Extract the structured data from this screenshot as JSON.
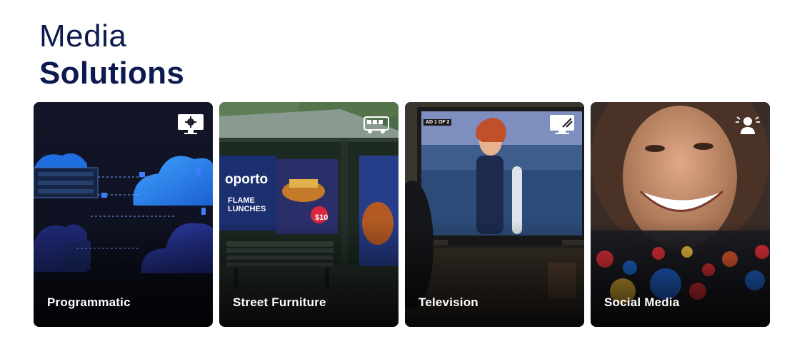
{
  "heading": {
    "line1": "Media",
    "line2": "Solutions"
  },
  "cards": [
    {
      "label": "Programmatic",
      "icon": "monitor-gear-icon"
    },
    {
      "label": "Street Furniture",
      "icon": "bus-icon",
      "ad_brand": "oporto",
      "ad_headline": "FLAME LUNCHES",
      "ad_price": "$10"
    },
    {
      "label": "Television",
      "icon": "tv-icon",
      "ad_counter": "AD 1 OF 2"
    },
    {
      "label": "Social Media",
      "icon": "person-broadcast-icon"
    }
  ],
  "colors": {
    "heading": "#0d1a4f",
    "card_label": "#ffffff"
  }
}
